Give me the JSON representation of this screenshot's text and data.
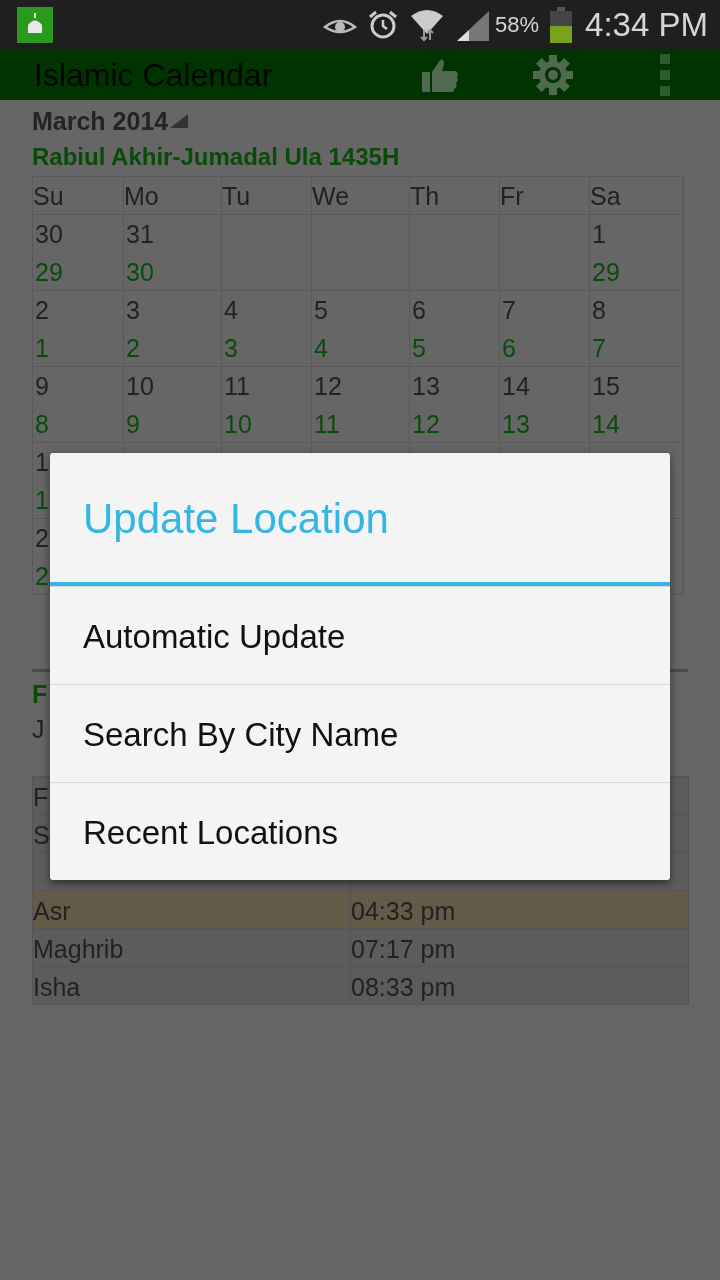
{
  "status_bar": {
    "battery": "58%",
    "time": "4:34 PM"
  },
  "app_bar": {
    "title": "Islamic Calendar"
  },
  "month": {
    "label": "March 2014"
  },
  "hijri_range": "Rabiul Akhir-Jumadal Ula 1435H",
  "calendar": {
    "weekdays": [
      "Su",
      "Mo",
      "Tu",
      "We",
      "Th",
      "Fr",
      "Sa"
    ],
    "weeks": [
      {
        "su": {
          "day": "30",
          "hijri": "29"
        },
        "mo": {
          "day": "31",
          "hijri": "30"
        },
        "sa": {
          "day": "1",
          "hijri": "29"
        }
      },
      {
        "su": {
          "day": "2",
          "hijri": "1"
        },
        "mo": {
          "day": "3",
          "hijri": "2"
        },
        "tu": {
          "day": "4",
          "hijri": "3"
        },
        "we": {
          "day": "5",
          "hijri": "4"
        },
        "th": {
          "day": "6",
          "hijri": "5"
        },
        "fr": {
          "day": "7",
          "hijri": "6"
        },
        "sa": {
          "day": "8",
          "hijri": "7"
        }
      },
      {
        "su": {
          "day": "9",
          "hijri": "8"
        },
        "mo": {
          "day": "10",
          "hijri": "9"
        },
        "tu": {
          "day": "11",
          "hijri": "10"
        },
        "we": {
          "day": "12",
          "hijri": "11"
        },
        "th": {
          "day": "13",
          "hijri": "12"
        },
        "fr": {
          "day": "14",
          "hijri": "13"
        },
        "sa": {
          "day": "15",
          "hijri": "14"
        }
      },
      {
        "su": {
          "day": "1",
          "hijri": "1"
        }
      },
      {
        "su": {
          "day": "2",
          "hijri": "2"
        }
      }
    ]
  },
  "day_info": {
    "line_1": "F",
    "line_2": "J"
  },
  "prayer_times": [
    {
      "name": "F",
      "highlighted": false
    },
    {
      "name": "S",
      "highlighted": false
    },
    {
      "highlighted": false
    },
    {
      "name": "Asr",
      "time": "04:33 pm",
      "highlighted": true
    },
    {
      "name": "Maghrib",
      "time": "07:17 pm",
      "highlighted": false
    },
    {
      "name": "Isha",
      "time": "08:33 pm",
      "highlighted": false
    }
  ],
  "dialog": {
    "title": "Update Location",
    "items": [
      "Automatic Update",
      "Search By City Name",
      "Recent Locations"
    ]
  }
}
